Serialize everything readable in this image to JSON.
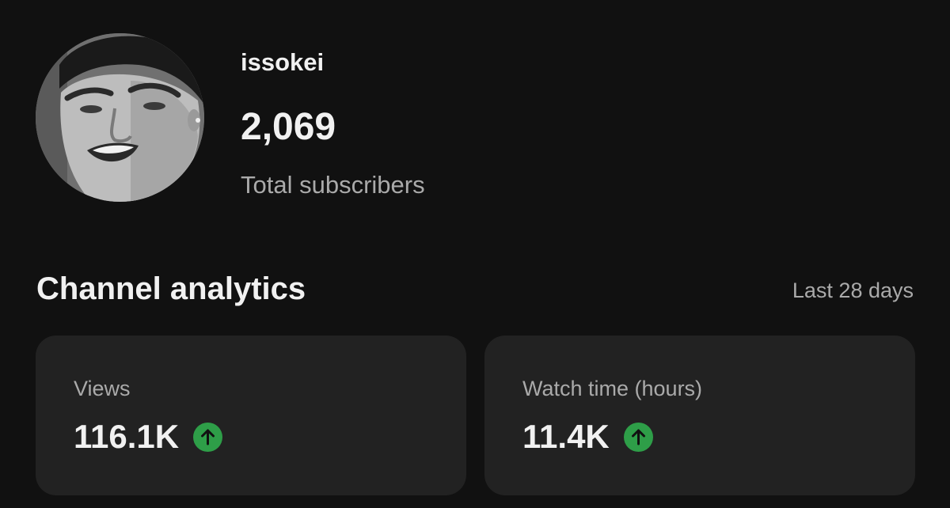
{
  "channel": {
    "name": "issokei",
    "subscriber_count": "2,069",
    "subscriber_label": "Total subscribers",
    "avatar_icon": "profile-photo"
  },
  "analytics": {
    "title": "Channel analytics",
    "period": "Last 28 days",
    "cards": [
      {
        "label": "Views",
        "value": "116.1K",
        "trend": "up",
        "trend_icon": "arrow-up-icon"
      },
      {
        "label": "Watch time (hours)",
        "value": "11.4K",
        "trend": "up",
        "trend_icon": "arrow-up-icon"
      }
    ]
  },
  "colors": {
    "background": "#111111",
    "card_background": "#222222",
    "primary_text": "#f1f1f1",
    "secondary_text": "#aaaaaa",
    "trend_up": "#2e9e48"
  }
}
